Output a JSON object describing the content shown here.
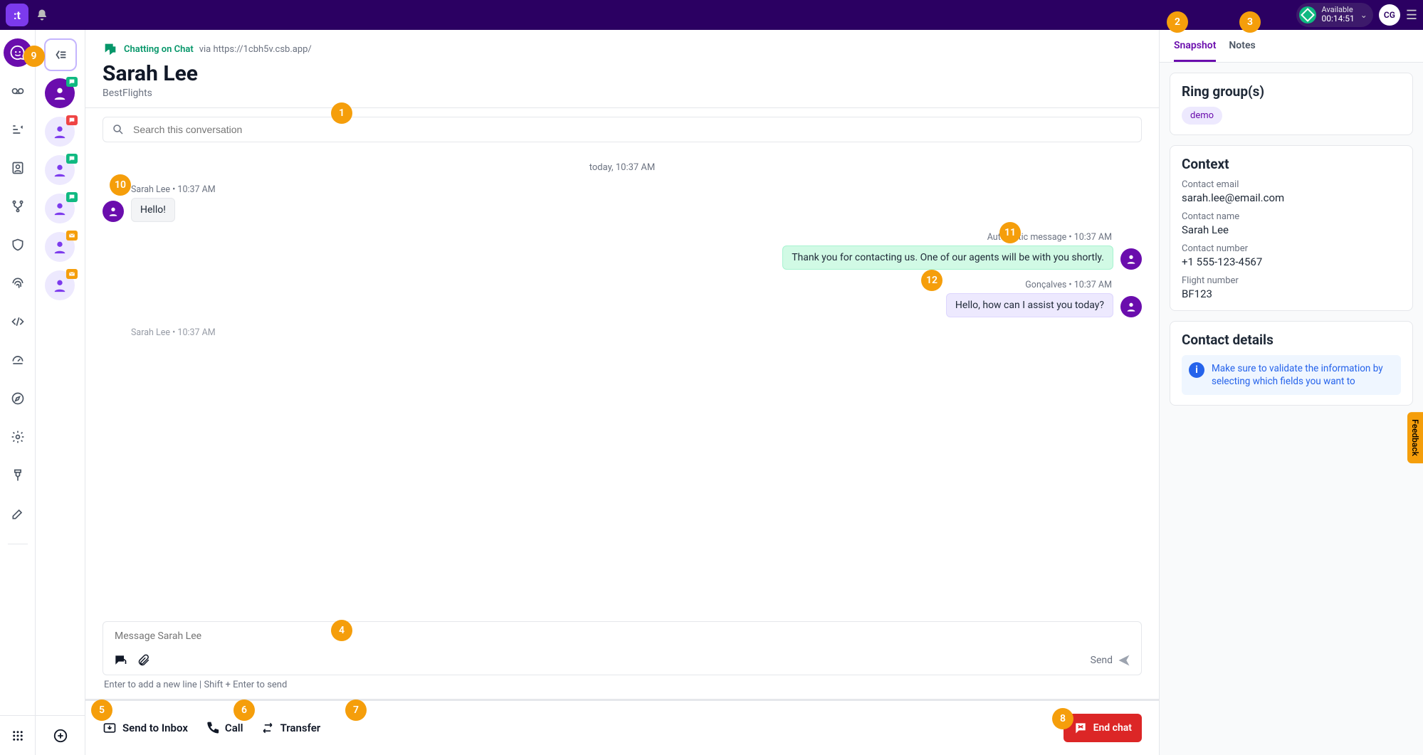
{
  "topbar": {
    "status_label": "Available",
    "status_timer": "00:14:51",
    "user_initials": "CG"
  },
  "header": {
    "channel_label": "Chatting on Chat",
    "via_label": "via https://1cbh5v.csb.app/",
    "customer_name": "Sarah Lee",
    "org_name": "BestFlights"
  },
  "search": {
    "placeholder": "Search this conversation"
  },
  "conversation": {
    "date_divider": "today, 10:37 AM",
    "messages": [
      {
        "sender": "Sarah Lee",
        "time": "10:37 AM",
        "text": "Hello!",
        "side": "left",
        "style": "plain"
      },
      {
        "sender": "Automatic message",
        "time": "10:37 AM",
        "text": "Thank you for contacting us. One of our agents will be with you shortly.",
        "side": "right",
        "style": "auto"
      },
      {
        "sender": "Gonçalves",
        "time": "10:37 AM",
        "text": "Hello, how can I assist you today?",
        "side": "right",
        "style": "agent"
      },
      {
        "sender": "Sarah Lee",
        "time": "10:37 AM",
        "text": "",
        "side": "left",
        "style": "plain",
        "partial": true
      }
    ]
  },
  "composer": {
    "placeholder": "Message Sarah Lee",
    "send_label": "Send",
    "hint": "Enter to add a new line | Shift + Enter to send"
  },
  "actions": {
    "send_to_inbox": "Send to Inbox",
    "call": "Call",
    "transfer": "Transfer",
    "end_chat": "End chat"
  },
  "tabs": {
    "snapshot": "Snapshot",
    "notes": "Notes"
  },
  "snapshot": {
    "ring_groups": {
      "title": "Ring group(s)",
      "chips": [
        "demo"
      ]
    },
    "context": {
      "title": "Context",
      "fields": [
        {
          "label": "Contact email",
          "value": "sarah.lee@email.com"
        },
        {
          "label": "Contact name",
          "value": "Sarah Lee"
        },
        {
          "label": "Contact number",
          "value": "+1 555-123-4567"
        },
        {
          "label": "Flight number",
          "value": "BF123"
        }
      ]
    },
    "contact_details": {
      "title": "Contact details",
      "info": "Make sure to validate the information by selecting which fields you want to"
    }
  },
  "feedback": {
    "label": "Feedback"
  },
  "annotations": {
    "1": "1",
    "2": "2",
    "3": "3",
    "4": "4",
    "5": "5",
    "6": "6",
    "7": "7",
    "8": "8",
    "9": "9",
    "10": "10",
    "11": "11",
    "12": "12"
  }
}
